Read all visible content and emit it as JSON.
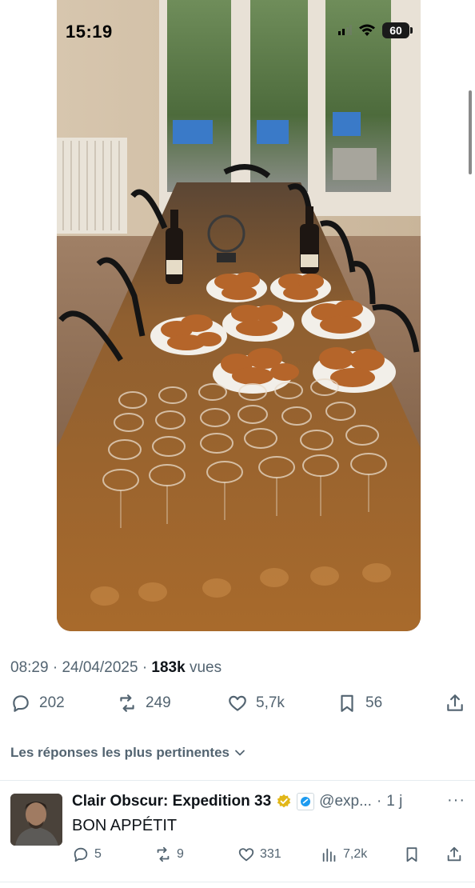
{
  "status_bar": {
    "time": "15:19",
    "battery": "60"
  },
  "tweet": {
    "time": "08:29",
    "date": "24/04/2025",
    "separator": "·",
    "views_count": "183k",
    "views_label": "vues",
    "replies": "202",
    "reposts": "249",
    "likes": "5,7k",
    "bookmarks": "56"
  },
  "replies_sort": {
    "label": "Les réponses les plus pertinentes"
  },
  "reply": {
    "name": "Clair Obscur: Expedition 33",
    "handle": "@exp...",
    "time": "1 j",
    "dot": "·",
    "more": "···",
    "text": "BON APPÉTIT",
    "replies": "5",
    "reposts": "9",
    "likes": "331",
    "views": "7,2k"
  },
  "colors": {
    "text_primary": "#0f1419",
    "text_secondary": "#536471",
    "divider": "#e6ecf0",
    "verified_gold": "#e2b719",
    "affiliate_blue": "#1d9bf0"
  },
  "icons": [
    "reply-icon",
    "repost-icon",
    "like-icon",
    "bookmark-icon",
    "share-icon",
    "chevron-down-icon",
    "views-icon",
    "verified-gold-icon",
    "affiliate-badge-icon",
    "more-icon",
    "signal-icon",
    "wifi-icon",
    "battery-icon"
  ]
}
